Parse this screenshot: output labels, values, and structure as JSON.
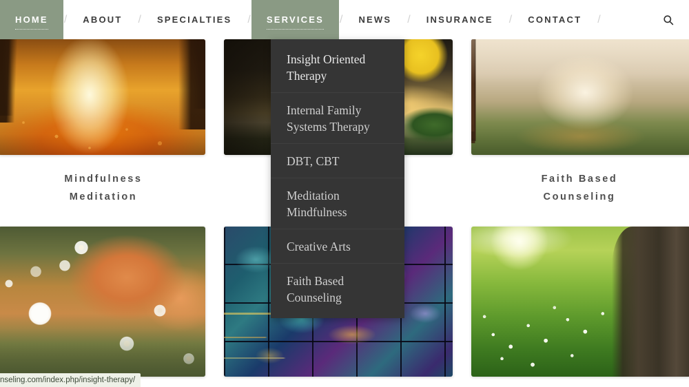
{
  "nav": {
    "items": [
      {
        "label": "HOME",
        "active": true,
        "has_dropdown": false
      },
      {
        "label": "ABOUT",
        "active": false,
        "has_dropdown": false
      },
      {
        "label": "SPECIALTIES",
        "active": false,
        "has_dropdown": false
      },
      {
        "label": "SERVICES",
        "active": true,
        "has_dropdown": true
      },
      {
        "label": "NEWS",
        "active": false,
        "has_dropdown": false
      },
      {
        "label": "INSURANCE",
        "active": false,
        "has_dropdown": false
      },
      {
        "label": "CONTACT",
        "active": false,
        "has_dropdown": false
      }
    ],
    "separator": "/",
    "search_icon": "search-icon",
    "active_background_color": "#8a9a84",
    "text_color": "#3b3b3b",
    "active_text_color": "#ffffff"
  },
  "dropdown": {
    "parent": "SERVICES",
    "background_color": "#353535",
    "text_color": "#cfcfcf",
    "items": [
      {
        "label": "Insight Oriented Therapy",
        "hovered": true
      },
      {
        "label": "Internal Family Systems Therapy",
        "hovered": false
      },
      {
        "label": "DBT, CBT",
        "hovered": false
      },
      {
        "label": "Meditation Mindfulness",
        "hovered": false
      },
      {
        "label": "Creative Arts",
        "hovered": false
      },
      {
        "label": "Faith Based Counseling",
        "hovered": false
      }
    ]
  },
  "gallery": {
    "row1": [
      {
        "name": "autumn-forest-path",
        "alt": "Autumn forest path covered in golden leaves with sunlight"
      },
      {
        "name": "sunflower-sunset",
        "alt": "Sunflower silhouetted against a sunset sky"
      },
      {
        "name": "misty-pine-forest",
        "alt": "Misty pine forest with sunbeams on a grassy trail"
      }
    ],
    "captions": [
      {
        "line1": "Mindfulness",
        "line2": "Meditation"
      },
      {
        "line1": "",
        "line2": ""
      },
      {
        "line1": "Faith Based",
        "line2": "Counseling"
      }
    ],
    "row2": [
      {
        "name": "daisies-terracotta-pots",
        "alt": "White daisies in front of blurred terracotta pots"
      },
      {
        "name": "glass-mosaic-tiles",
        "alt": "Teal and purple iridescent glass mosaic tiles"
      },
      {
        "name": "sunlit-meadow-tree",
        "alt": "Sunlit green meadow with white flowers beside a tree trunk"
      }
    ]
  },
  "status_bar": {
    "url": "nseling.com/index.php/insight-therapy/"
  }
}
